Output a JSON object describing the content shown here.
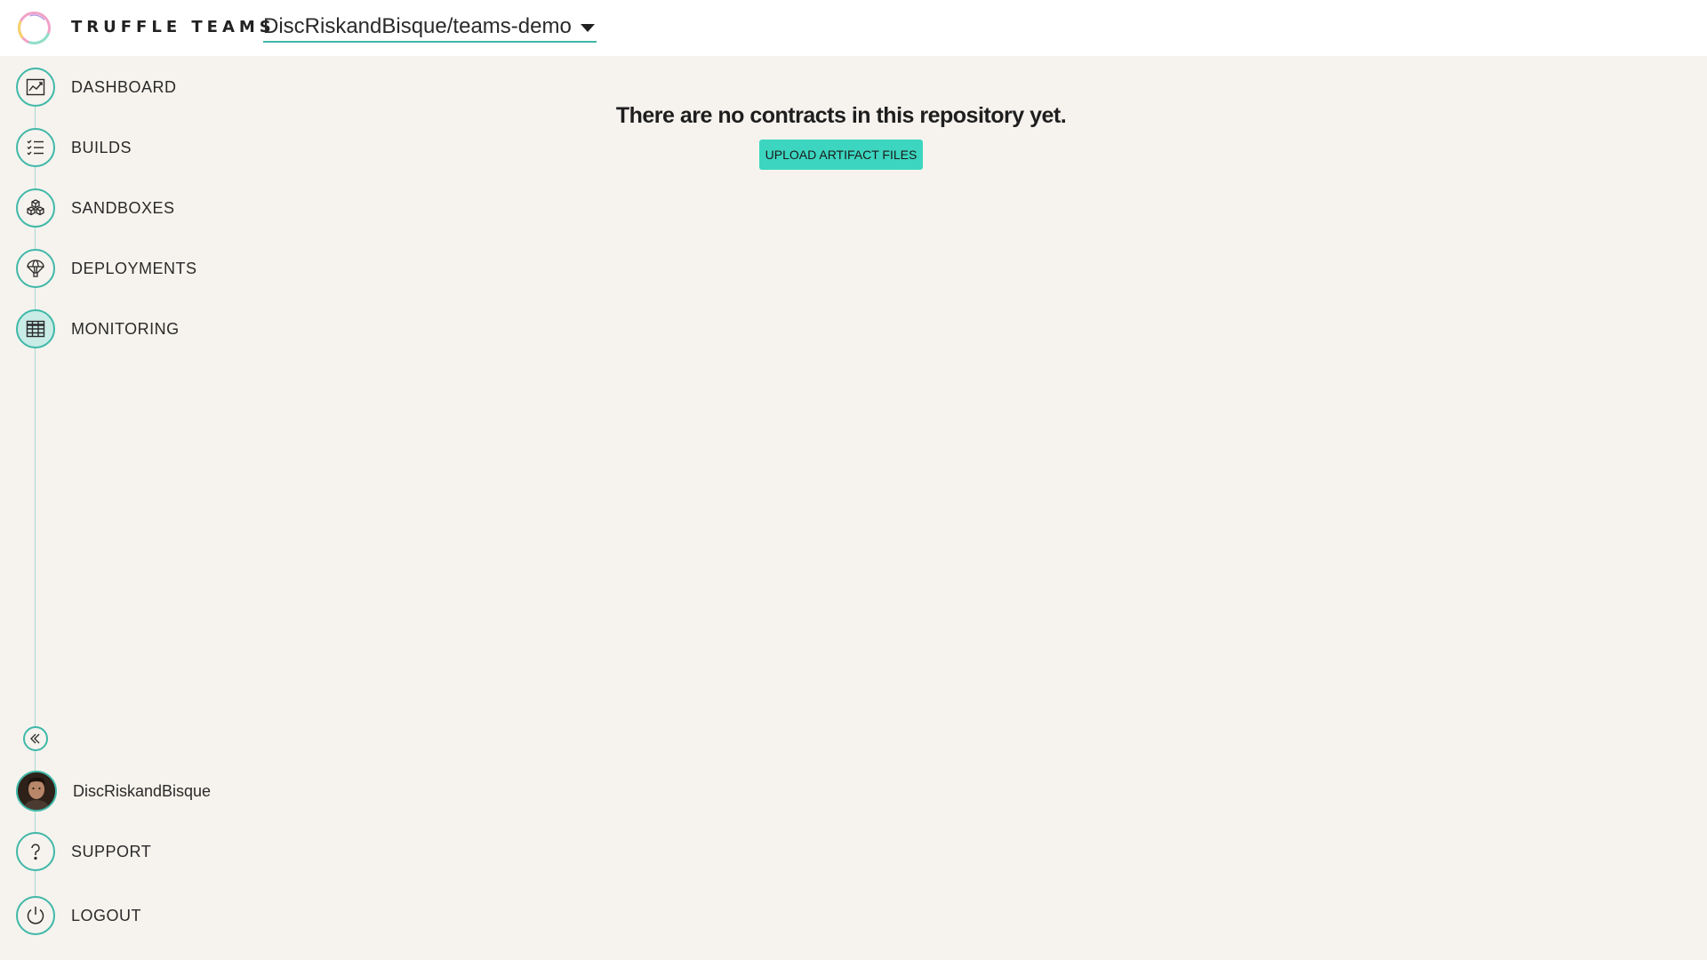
{
  "header": {
    "brand": "TRUFFLE TEAMS",
    "repo": "DiscRiskandBisque/teams-demo"
  },
  "sidebar": {
    "items": [
      {
        "label": "DASHBOARD",
        "icon": "chart-icon"
      },
      {
        "label": "BUILDS",
        "icon": "checklist-icon"
      },
      {
        "label": "SANDBOXES",
        "icon": "cubes-icon"
      },
      {
        "label": "DEPLOYMENTS",
        "icon": "parachute-icon"
      },
      {
        "label": "MONITORING",
        "icon": "grid-table-icon",
        "active": true
      }
    ],
    "user": "DiscRiskandBisque",
    "support": "SUPPORT",
    "logout": "LOGOUT"
  },
  "main": {
    "empty_message": "There are no contracts in this repository yet.",
    "upload_button": "UPLOAD ARTIFACT FILES"
  },
  "colors": {
    "accent": "#3fb8a8",
    "button": "#3cd6c0",
    "background": "#f6f3ee"
  }
}
